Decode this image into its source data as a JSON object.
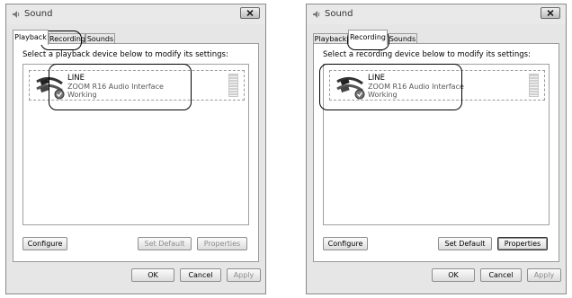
{
  "windows": [
    {
      "title": "Sound",
      "tabs": [
        {
          "label": "Playback"
        },
        {
          "label": "Recording"
        },
        {
          "label": "Sounds"
        }
      ],
      "active_tab": 0,
      "prompt": "Select a playback device below to modify its settings:",
      "device": {
        "name": "LINE",
        "description": "ZOOM R16 Audio Interface",
        "status": "Working"
      },
      "buttons": {
        "configure": "Configure",
        "set_default": "Set Default",
        "properties": "Properties",
        "ok": "OK",
        "cancel": "Cancel",
        "apply": "Apply"
      }
    },
    {
      "title": "Sound",
      "tabs": [
        {
          "label": "Playback"
        },
        {
          "label": "Recording"
        },
        {
          "label": "Sounds"
        }
      ],
      "active_tab": 1,
      "prompt": "Select a recording device below to modify its settings:",
      "device": {
        "name": "LINE",
        "description": "ZOOM R16 Audio Interface",
        "status": "Working"
      },
      "buttons": {
        "configure": "Configure",
        "set_default": "Set Default",
        "properties": "Properties",
        "ok": "OK",
        "cancel": "Cancel",
        "apply": "Apply"
      }
    }
  ]
}
